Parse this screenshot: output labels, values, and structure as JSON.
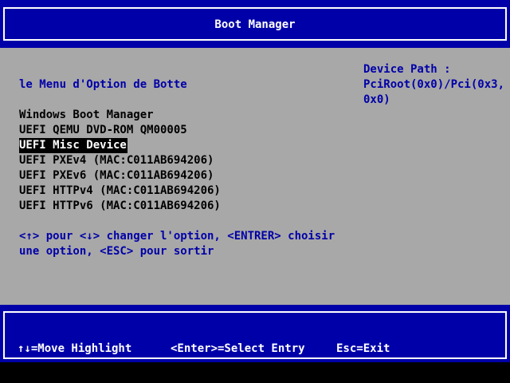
{
  "header": {
    "title": "Boot Manager"
  },
  "menu": {
    "title": "le Menu d'Option de Botte",
    "entries": [
      "Windows Boot Manager",
      "UEFI QEMU DVD-ROM QM00005",
      "UEFI Misc Device",
      "UEFI PXEv4 (MAC:C011AB694206)",
      "UEFI PXEv6 (MAC:C011AB694206)",
      "UEFI HTTPv4 (MAC:C011AB694206)",
      "UEFI HTTPv6 (MAC:C011AB694206)"
    ],
    "selected_entry": "UEFI Misc Device",
    "help": "<↑> pour <↓> changer l'option, <ENTRER> choisir une option, <ESC> pour sortir"
  },
  "device_path": {
    "label": "Device Path :",
    "value": "PciRoot(0x0)/Pci(0x3,0x0)"
  },
  "footer": {
    "move": "↑↓=Move Highlight",
    "select": "<Enter>=Select Entry",
    "exit": "Esc=Exit"
  },
  "colors": {
    "header_background": "#0000a8",
    "body_background": "#a8a8a8",
    "text_blue": "#0000a8",
    "text_black": "#000000",
    "highlight_background": "#000000",
    "highlight_text": "#ffffff"
  }
}
